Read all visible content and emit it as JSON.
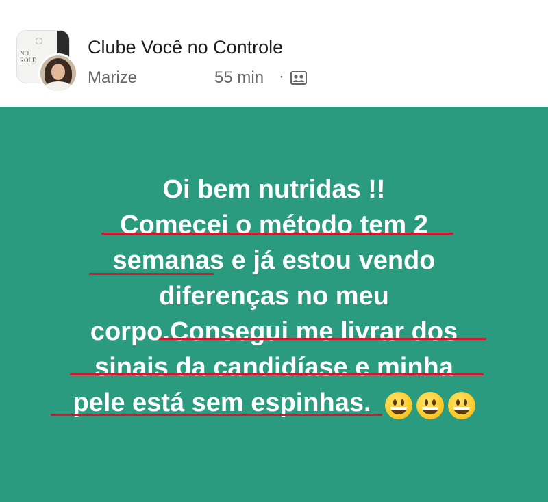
{
  "header": {
    "group_name": "Clube Você no Controle",
    "author": "Marize",
    "time": "55 min",
    "separator": "·",
    "audience_icon": "group-audience-icon",
    "group_thumb_text": "NO\nROLE"
  },
  "post": {
    "background_color": "#2b9b80",
    "text_color": "#ffffff",
    "underline_color": "#d4162f",
    "lines": [
      "Oi bem nutridas !!",
      "Comecei o método tem 2",
      "semanas e já estou vendo",
      "diferenças no meu",
      "corpo.Consegui me livrar dos",
      "sinais da candidíase e minha",
      "pele está sem espinhas."
    ],
    "emojis": [
      "grinning-face-emoji",
      "grinning-face-emoji",
      "grinning-face-emoji"
    ]
  }
}
